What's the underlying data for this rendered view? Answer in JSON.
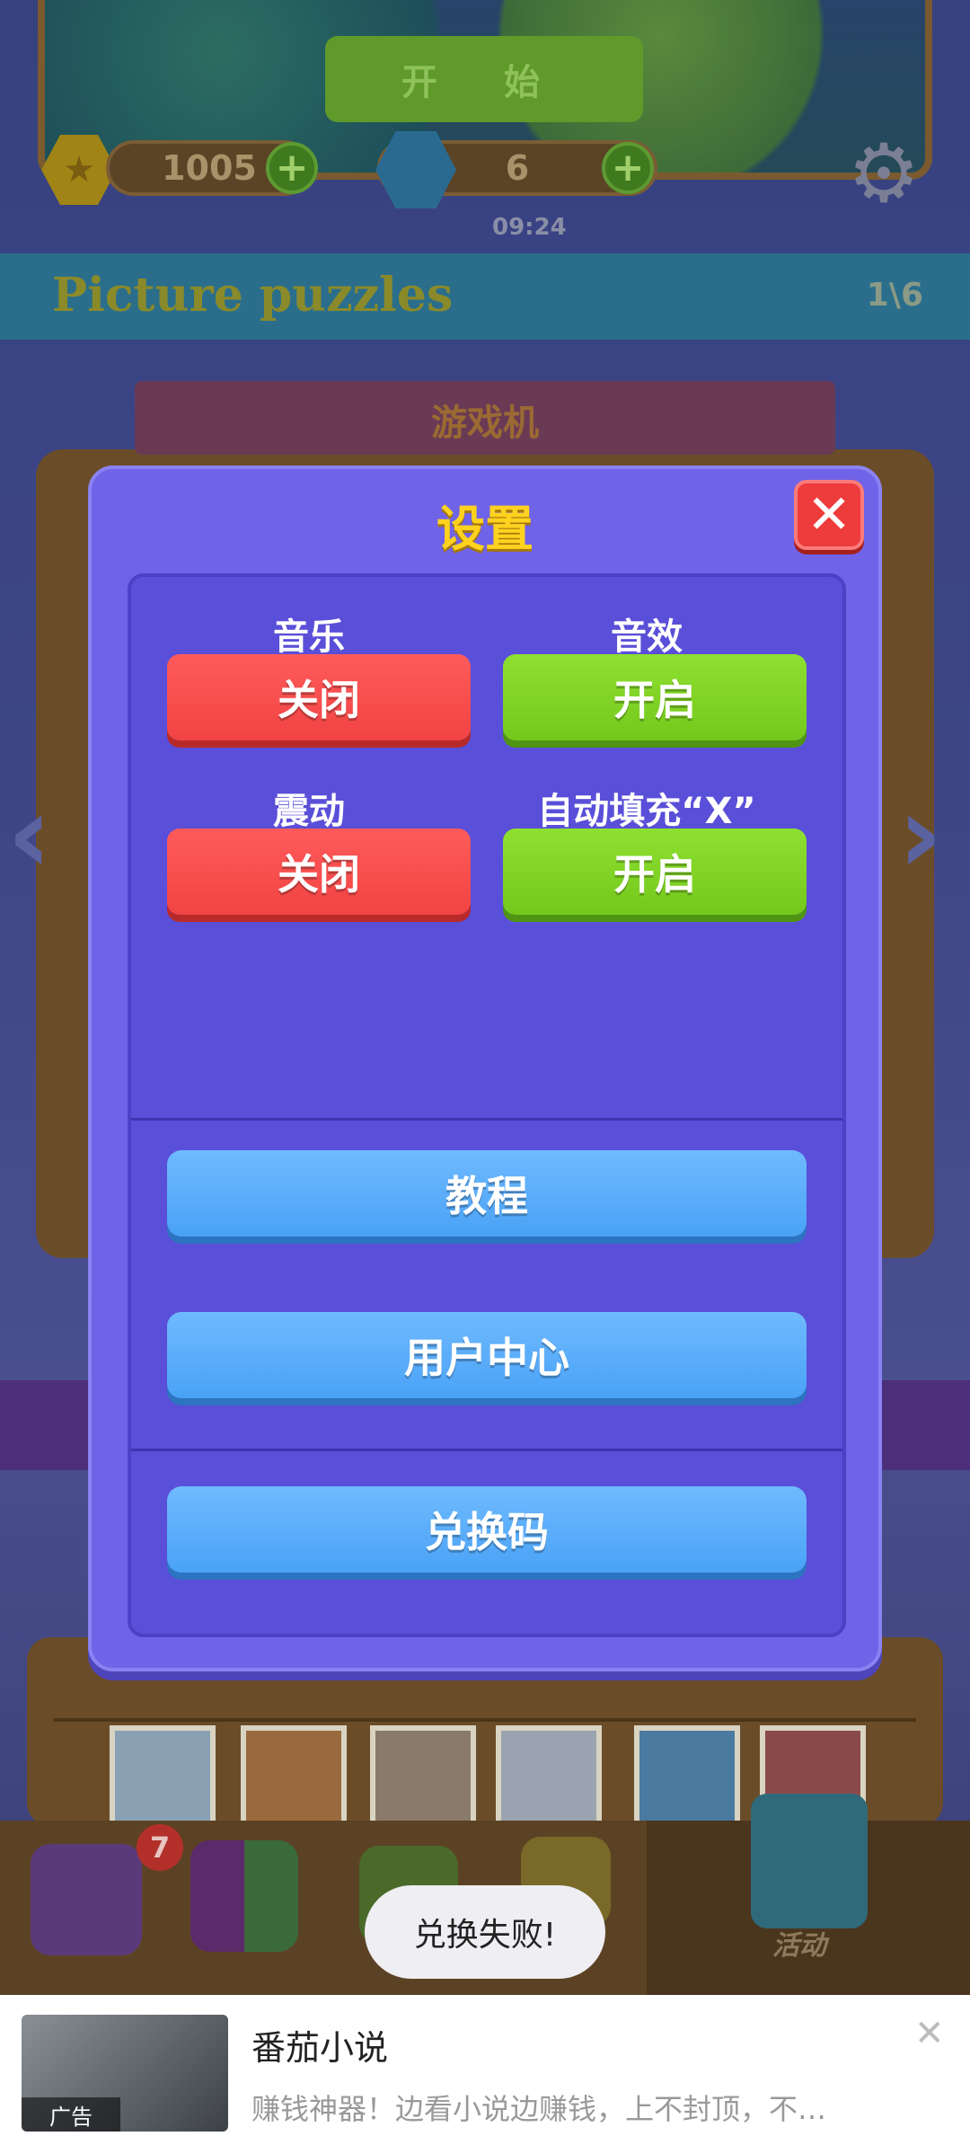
{
  "top": {
    "start_label": "开 始",
    "coins": "1005",
    "gems": "6",
    "timer": "09:24"
  },
  "banner": {
    "title": "Picture puzzles",
    "progress": "1\\6"
  },
  "ribbon": {
    "label": "游戏机"
  },
  "settings": {
    "title": "设置",
    "music": {
      "label": "音乐",
      "state": "关闭"
    },
    "sound": {
      "label": "音效",
      "state": "开启"
    },
    "vibration": {
      "label": "震动",
      "state": "关闭"
    },
    "autofill": {
      "label": "自动填充“X”",
      "state": "开启"
    },
    "tutorial": "教程",
    "user_center": "用户中心",
    "redeem_code": "兑换码"
  },
  "tabbar": {
    "badge_count": "7",
    "activity_label": "活动"
  },
  "toast": {
    "message": "兑换失败!"
  },
  "ad": {
    "tag": "广告",
    "title": "番茄小说",
    "subtitle": "赚钱神器！边看小说边赚钱，上不封顶，不…"
  },
  "colors": {
    "dialog": "#6f63e8",
    "title_yellow": "#ffd21f",
    "off_red": "#f14343",
    "on_green": "#74c81c",
    "action_blue": "#4aa2f6"
  }
}
